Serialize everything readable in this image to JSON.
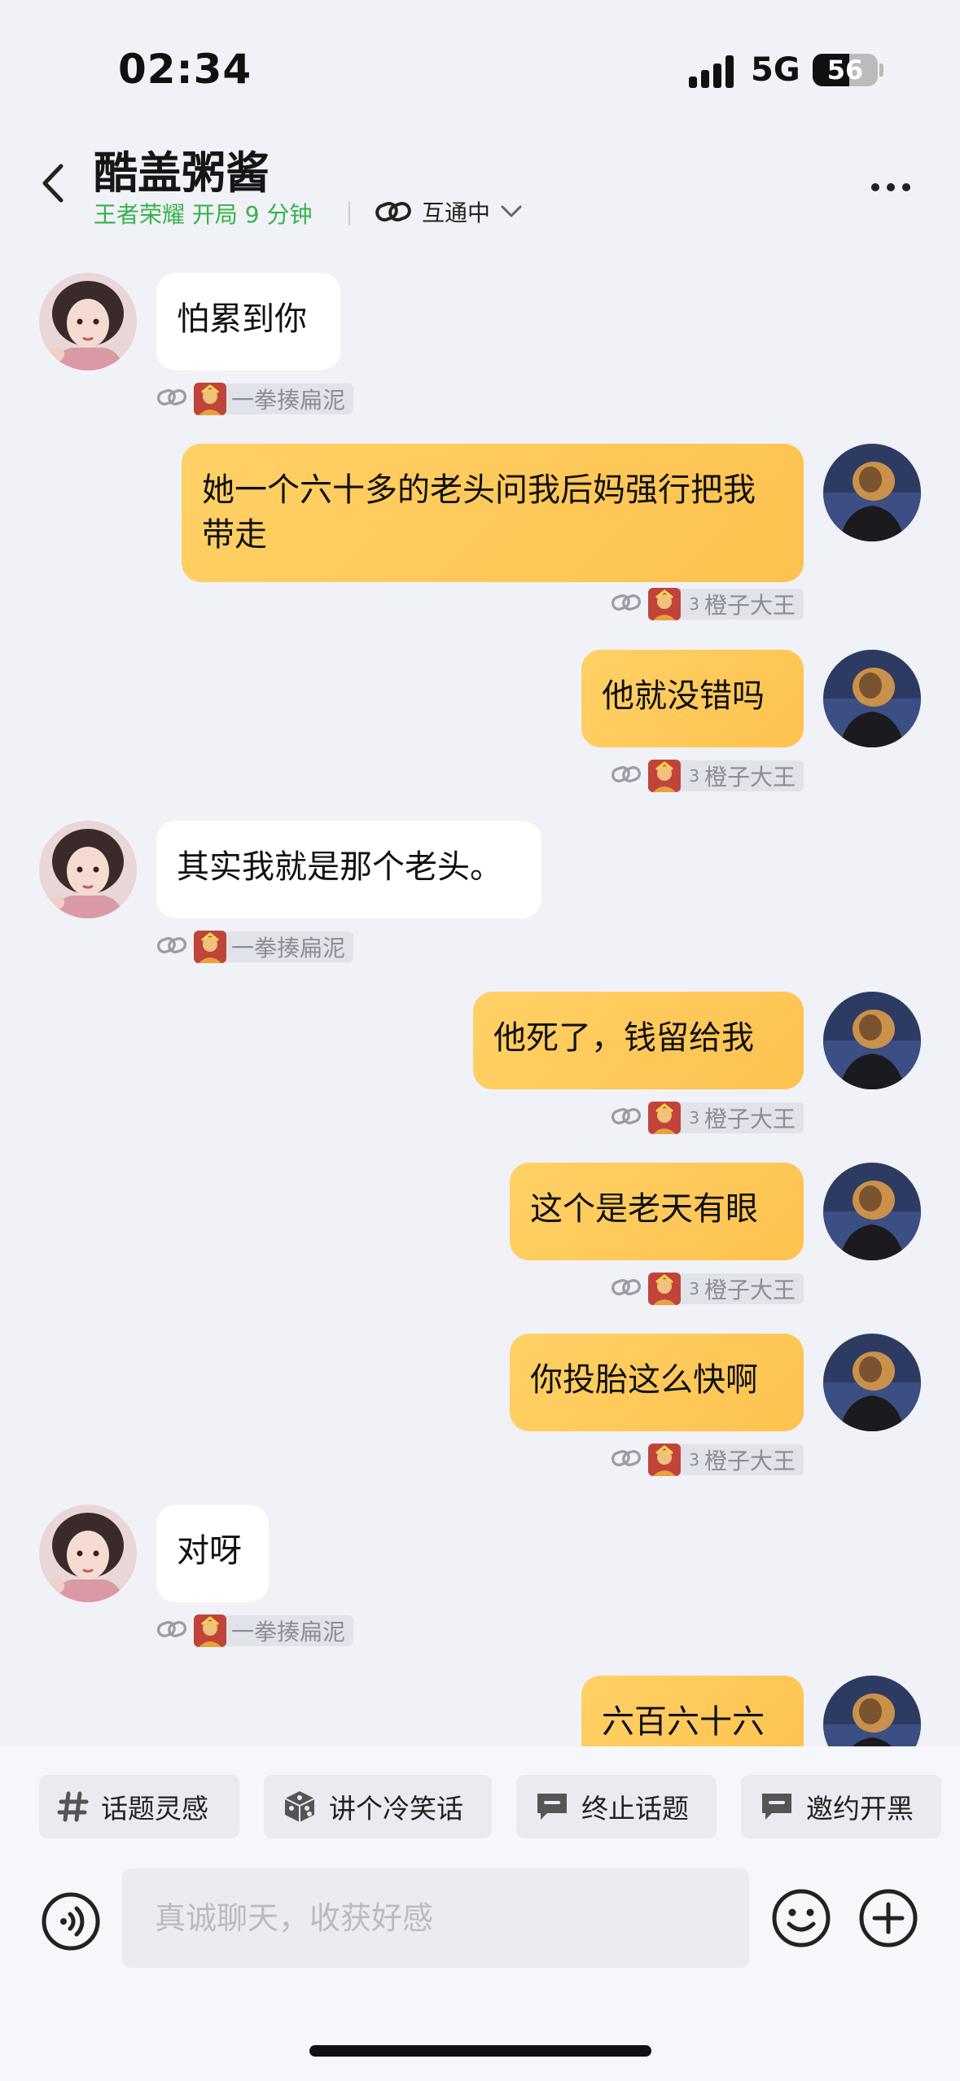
{
  "status_bar": {
    "time": "02:34",
    "network": "5G",
    "battery": "56",
    "battery_level": 0.56
  },
  "header": {
    "name": "酷盖粥酱",
    "game_status": "王者荣耀 开局 9 分钟",
    "link_status": "互通中",
    "icons": [
      "back-arrow-icon",
      "link-icon",
      "chevron-down-icon",
      "more-icon"
    ]
  },
  "messages": [
    {
      "side": "in",
      "text": "怕累到你",
      "nick": "一拳揍扁泥"
    },
    {
      "side": "out",
      "text": "她一个六十多的老头问我后妈强行把我带走",
      "rank": "3",
      "nick": "橙子大王"
    },
    {
      "side": "out",
      "text": "他就没错吗",
      "rank": "3",
      "nick": "橙子大王"
    },
    {
      "side": "in",
      "text": "其实我就是那个老头。",
      "nick": "一拳揍扁泥"
    },
    {
      "side": "out",
      "text": "他死了，钱留给我",
      "rank": "3",
      "nick": "橙子大王"
    },
    {
      "side": "out",
      "text": "这个是老天有眼",
      "rank": "3",
      "nick": "橙子大王"
    },
    {
      "side": "out",
      "text": "你投胎这么快啊",
      "rank": "3",
      "nick": "橙子大王"
    },
    {
      "side": "in",
      "text": "对呀",
      "nick": "一拳揍扁泥"
    },
    {
      "side": "out",
      "text": "六百六十六",
      "rank": "",
      "nick": ""
    }
  ],
  "quick_actions": [
    {
      "label": "话题灵感",
      "icon": "hash-icon"
    },
    {
      "label": "讲个冷笑话",
      "icon": "dice-icon"
    },
    {
      "label": "终止话题",
      "icon": "chat-bubble-icon"
    },
    {
      "label": "邀约开黑",
      "icon": "chat-bubble-icon"
    }
  ],
  "input": {
    "placeholder": "真诚聊天，收获好感",
    "value": ""
  },
  "colors": {
    "outgoing_bubble": "#fec24f",
    "incoming_bubble": "#ffffff",
    "game_status": "#35b24a",
    "background": "#f1f2f7"
  }
}
